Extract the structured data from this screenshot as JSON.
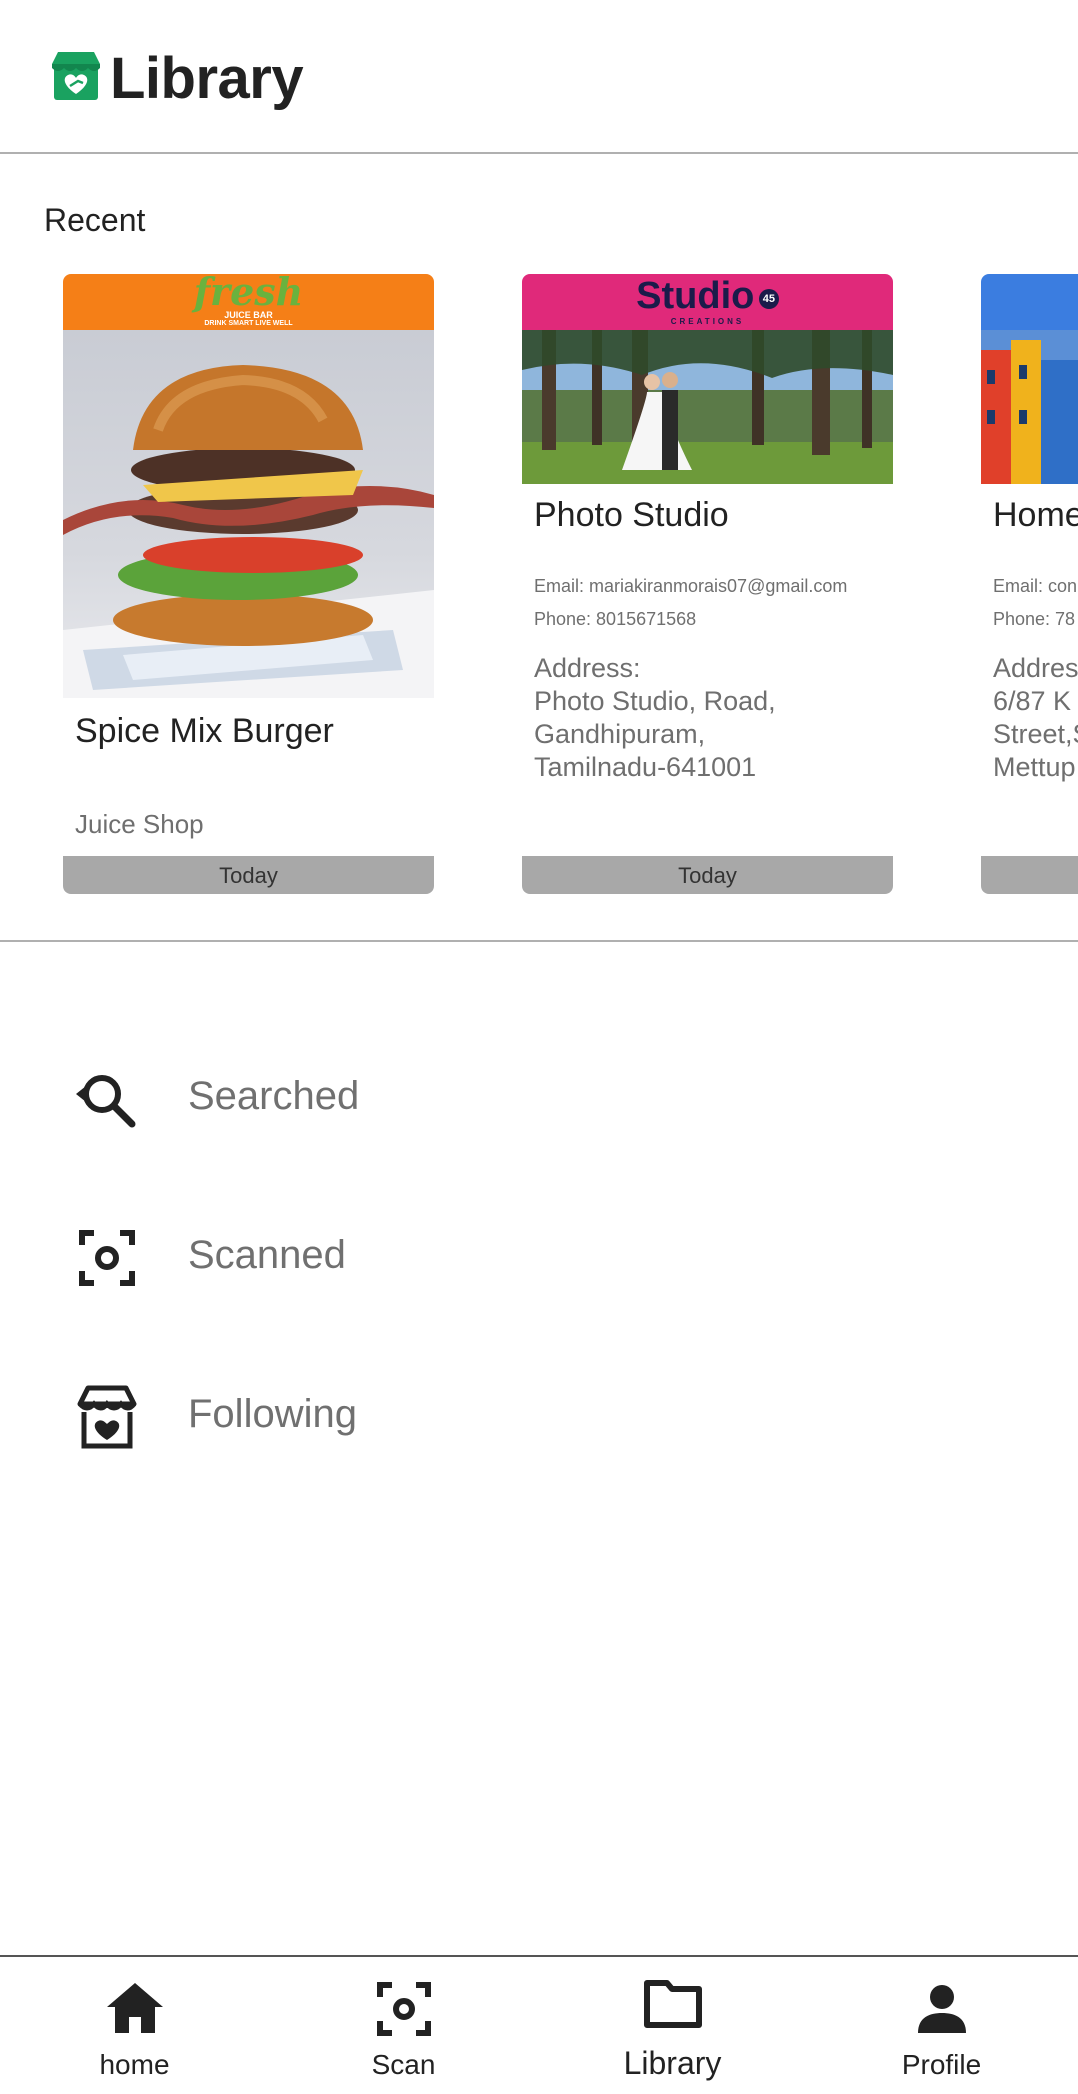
{
  "header": {
    "title": "Library",
    "logo_icon": "store-heart-icon",
    "logo_color": "#1aa260"
  },
  "recent": {
    "label": "Recent",
    "cards": [
      {
        "banner_color": "#f57f17",
        "banner_logo": "fresh",
        "banner_tagline": "JUICE BAR",
        "banner_slogan": "DRINK SMART LIVE WELL",
        "title": "Spice Mix Burger",
        "subtitle": "Juice Shop",
        "date": "Today"
      },
      {
        "banner_color": "#e0297a",
        "banner_logo": "Studio",
        "banner_badge": "45",
        "banner_tagline": "CREATIONS",
        "title": "Photo Studio",
        "email": "Email: mariakiranmorais07@gmail.com",
        "phone": "Phone: 8015671568",
        "address_label": "Address:",
        "address": "Photo Studio, Road,\nGandhipuram,\nTamilnadu-641001",
        "date": "Today"
      },
      {
        "banner_color": "#3b7de0",
        "title": "Home",
        "email": "Email: con",
        "phone": "Phone: 78",
        "address_label": "Address",
        "address": "6/87 K\nStreet,S\nMettup",
        "date": ""
      }
    ]
  },
  "menu": [
    {
      "label": "Searched",
      "icon": "search-history-icon"
    },
    {
      "label": "Scanned",
      "icon": "scan-icon"
    },
    {
      "label": "Following",
      "icon": "store-heart-icon"
    }
  ],
  "bottom_nav": [
    {
      "label": "home",
      "icon": "home-icon"
    },
    {
      "label": "Scan",
      "icon": "scan-icon"
    },
    {
      "label": "Library",
      "icon": "folder-icon",
      "active": true
    },
    {
      "label": "Profile",
      "icon": "person-icon"
    }
  ]
}
